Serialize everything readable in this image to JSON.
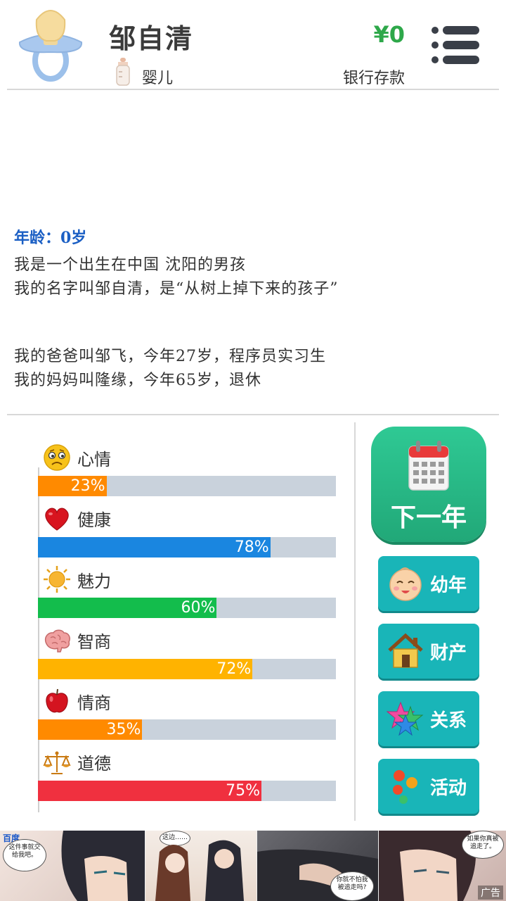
{
  "header": {
    "name": "邹自清",
    "stage": "婴儿",
    "money": "¥0",
    "bank_label": "银行存款"
  },
  "story": {
    "age_line": "年龄：0岁",
    "lines": [
      "我是一个出生在中国 沈阳的男孩",
      "我的名字叫邹自清，是“从树上掉下来的孩子”"
    ],
    "family": [
      "我的爸爸叫邹飞，今年27岁，程序员实习生",
      "我的妈妈叫隆缘，今年65岁，退休"
    ]
  },
  "stats": [
    {
      "label": "心情",
      "value": 23,
      "pct": "23%",
      "color": "#ff8a00",
      "icon": "sad-face-icon"
    },
    {
      "label": "健康",
      "value": 78,
      "pct": "78%",
      "color": "#1a86e0",
      "icon": "heart-icon"
    },
    {
      "label": "魅力",
      "value": 60,
      "pct": "60%",
      "color": "#13bd4c",
      "icon": "sun-icon"
    },
    {
      "label": "智商",
      "value": 72,
      "pct": "72%",
      "color": "#ffb300",
      "icon": "brain-icon"
    },
    {
      "label": "情商",
      "value": 35,
      "pct": "35%",
      "color": "#ff8a00",
      "icon": "apple-icon"
    },
    {
      "label": "道德",
      "value": 75,
      "pct": "75%",
      "color": "#f0303f",
      "icon": "scale-icon"
    }
  ],
  "actions": {
    "next_year": "下一年",
    "childhood": "幼年",
    "property": "财产",
    "relations": "关系",
    "activities": "活动"
  },
  "ad": {
    "brand": "百度",
    "badge": "广告",
    "bubbles": [
      "这件事就交给我吧。",
      "这边……",
      "如果你真被追走了。",
      "你就不怕我被追走吗?"
    ]
  },
  "colors": {
    "accent_green": "#2ea84a",
    "next_year_button": "#21a878",
    "side_button": "#19b5b8",
    "age_blue": "#1b5fc4"
  }
}
